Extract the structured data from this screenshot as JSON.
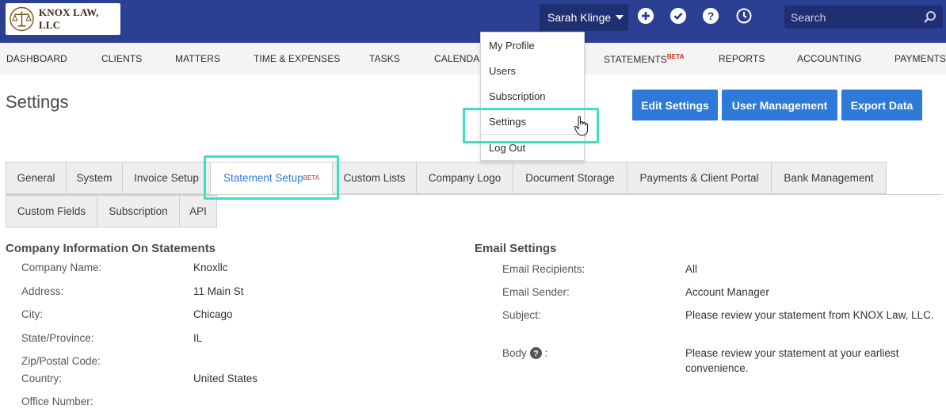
{
  "header": {
    "logo_text": "KNOX LAW, LLC",
    "user_name": "Sarah Klinge",
    "search_placeholder": "Search"
  },
  "nav": [
    "DASHBOARD",
    "CLIENTS",
    "MATTERS",
    "TIME & EXPENSES",
    "TASKS",
    "CALENDAR",
    "STATEMENTS",
    "REPORTS",
    "ACCOUNTING",
    "PAYMENTS"
  ],
  "nav_beta": "BETA",
  "page": {
    "title": "Settings",
    "buttons": [
      "Edit Settings",
      "User Management",
      "Export Data"
    ]
  },
  "dropdown": [
    "My Profile",
    "Users",
    "Subscription",
    "Settings",
    "Log Out"
  ],
  "tabs_row1": [
    "General",
    "System",
    "Invoice Setup",
    "Statement Setup",
    "Custom Lists",
    "Company Logo",
    "Document Storage",
    "Payments & Client Portal",
    "Bank Management"
  ],
  "tab_beta": "BETA",
  "tabs_row2": [
    "Custom Fields",
    "Subscription",
    "API"
  ],
  "company": {
    "title": "Company Information On Statements",
    "rows": [
      {
        "label": "Company Name:",
        "value": "Knoxllc"
      },
      {
        "label": "Address:",
        "value": "11 Main St"
      },
      {
        "label": "City:",
        "value": "Chicago"
      },
      {
        "label": "State/Province:",
        "value": "IL"
      },
      {
        "label": "Zip/Postal Code:",
        "value": ""
      },
      {
        "label": "Country:",
        "value": "United States"
      },
      {
        "label": "Office Number:",
        "value": ""
      }
    ]
  },
  "email": {
    "title": "Email Settings",
    "rows": [
      {
        "label": "Email Recipients:",
        "value": "All"
      },
      {
        "label": "Email Sender:",
        "value": "Account Manager"
      },
      {
        "label": "Subject:",
        "value": "Please review your statement from KNOX Law, LLC."
      },
      {
        "label": "Body",
        "suffix": ":",
        "value": "Please review your statement at your earliest convenience."
      }
    ]
  },
  "colors": {
    "header_bg": "#2b3f93",
    "primary_button": "#2f7ad9",
    "highlight": "#3de0c0",
    "beta": "#d9261c"
  }
}
